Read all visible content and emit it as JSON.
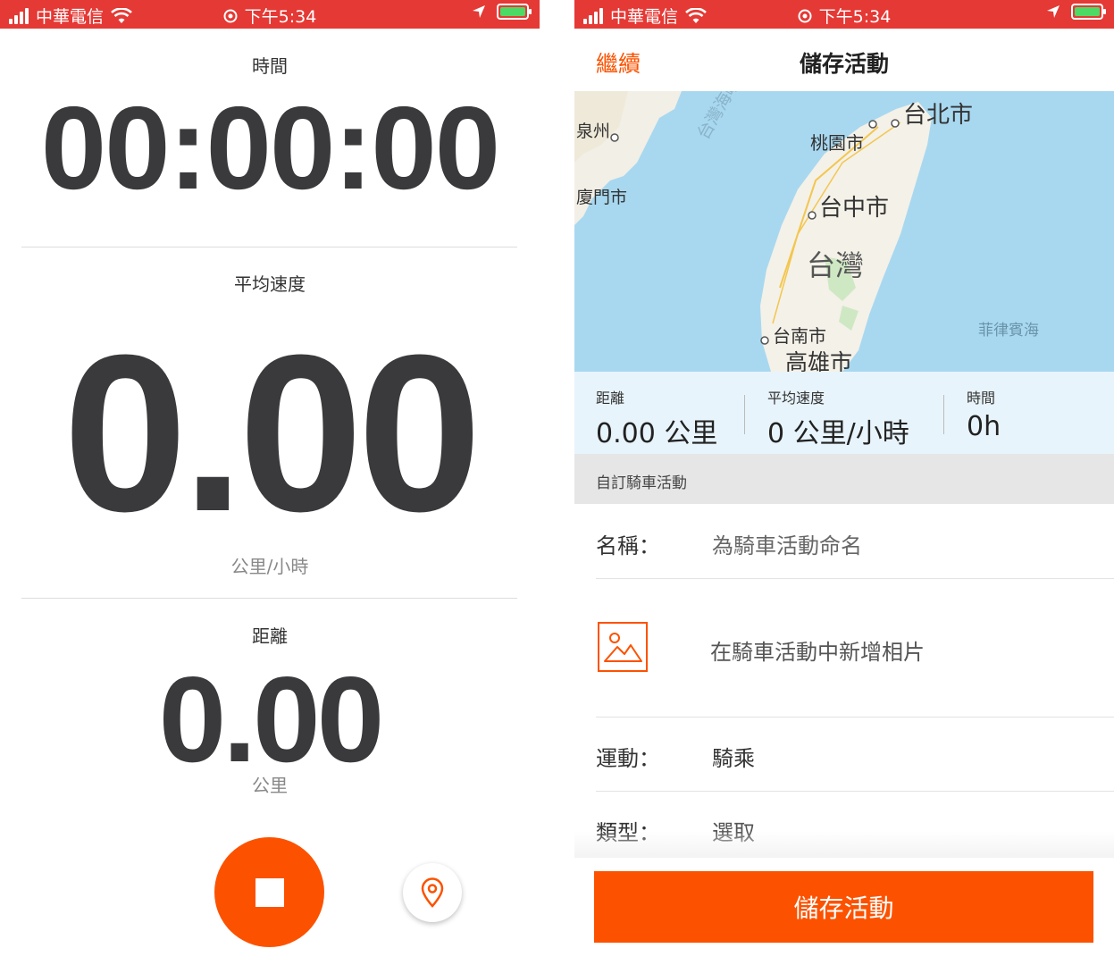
{
  "status_bar": {
    "carrier": "中華電信",
    "time": "下午5:34"
  },
  "tracker": {
    "time_label": "時間",
    "time_value": "00:00:00",
    "avg_speed_label": "平均速度",
    "avg_speed_value": "0.00",
    "avg_speed_unit": "公里/小時",
    "distance_label": "距離",
    "distance_value": "0.00",
    "distance_unit": "公里"
  },
  "save_screen": {
    "back_label": "繼續",
    "title": "儲存活動",
    "map_labels": {
      "quanzhou": "泉州",
      "xiamen": "廈門市",
      "strait": "台灣海峽",
      "taoyuan": "桃園市",
      "taipei": "台北市",
      "taichung": "台中市",
      "taiwan": "台灣",
      "tainan": "台南市",
      "kaohsiung": "高雄市",
      "philippine_sea": "菲律賓海"
    },
    "stats": [
      {
        "label": "距離",
        "value": "0.00 公里"
      },
      {
        "label": "平均速度",
        "value": "0 公里/小時"
      },
      {
        "label": "時間",
        "value": "0h"
      }
    ],
    "section_title": "自訂騎車活動",
    "name_label": "名稱：",
    "name_placeholder": "為騎車活動命名",
    "photo_label": "在騎車活動中新增相片",
    "sport_label": "運動：",
    "sport_value": "騎乘",
    "type_label": "類型：",
    "type_value": "選取",
    "save_button": "儲存活動"
  },
  "colors": {
    "status_bar": "#e53935",
    "accent": "#fc5200",
    "map_water": "#a8d8f0",
    "stats_bg": "#e8f4fb"
  }
}
